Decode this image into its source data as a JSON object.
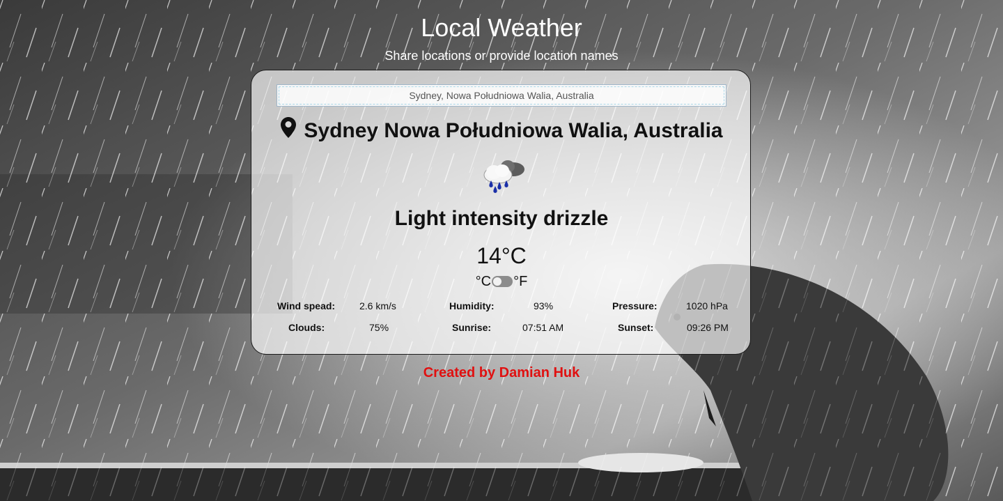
{
  "app": {
    "title": "Local Weather",
    "subtitle": "Share locations or provide location names",
    "footer": "Created by Damian Huk"
  },
  "search": {
    "value": "Sydney, Nowa Południowa Walia, Australia"
  },
  "weather": {
    "location": "Sydney Nowa Południowa Walia, Australia",
    "location_icon": "map-pin-icon",
    "condition_icon": "rain-cloud-icon",
    "description": "Light intensity drizzle",
    "temperature": "14°C",
    "unit_celsius": "°C",
    "unit_fahrenheit": "°F"
  },
  "stats": {
    "wind_label": "Wind spead:",
    "wind_value": "2.6 km/s",
    "humidity_label": "Humidity:",
    "humidity_value": "93%",
    "pressure_label": "Pressure:",
    "pressure_value": "1020 hPa",
    "clouds_label": "Clouds:",
    "clouds_value": "75%",
    "sunrise_label": "Sunrise:",
    "sunrise_value": "07:51 AM",
    "sunset_label": "Sunset:",
    "sunset_value": "09:26 PM"
  },
  "colors": {
    "footer": "#e01010",
    "card_background": "rgba(255,255,255,0.68)",
    "page_text": "#ffffff"
  }
}
